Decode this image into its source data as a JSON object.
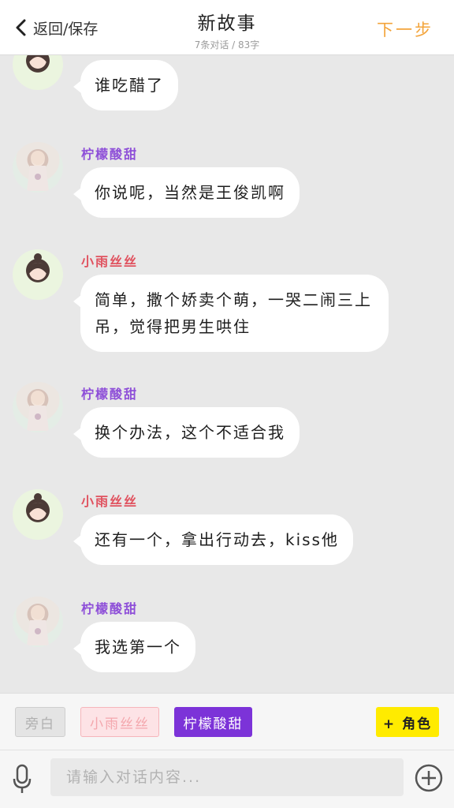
{
  "header": {
    "back_label": "返回/保存",
    "title": "新故事",
    "subtitle": "7条对话 / 83字",
    "next_label": "下一步"
  },
  "messages": [
    {
      "speaker": "",
      "speaker_type": "rain",
      "text": "谁吃醋了"
    },
    {
      "speaker": "柠檬酸甜",
      "speaker_type": "lemon",
      "text": "你说呢，当然是王俊凯啊"
    },
    {
      "speaker": "小雨丝丝",
      "speaker_type": "rain",
      "text": "简单，撒个娇卖个萌，一哭二闹三上吊，觉得把男生哄住"
    },
    {
      "speaker": "柠檬酸甜",
      "speaker_type": "lemon",
      "text": "换个办法，这个不适合我"
    },
    {
      "speaker": "小雨丝丝",
      "speaker_type": "rain",
      "text": "还有一个，拿出行动去，kiss他"
    },
    {
      "speaker": "柠檬酸甜",
      "speaker_type": "lemon",
      "text": "我选第一个"
    }
  ],
  "roles": {
    "narrator": "旁白",
    "role_rain": "小雨丝丝",
    "role_lemon": "柠檬酸甜",
    "add_role": "+ 角色"
  },
  "input": {
    "placeholder": "请输入对话内容..."
  },
  "icons": {
    "back": "chevron-left-icon",
    "mic": "microphone-icon",
    "add": "plus-circle-icon"
  },
  "colors": {
    "next": "#f3a43b",
    "lemon": "#8e4fd8",
    "rain": "#e0525f",
    "selected_role": "#7c33d8",
    "add_role": "#ffeb00"
  }
}
